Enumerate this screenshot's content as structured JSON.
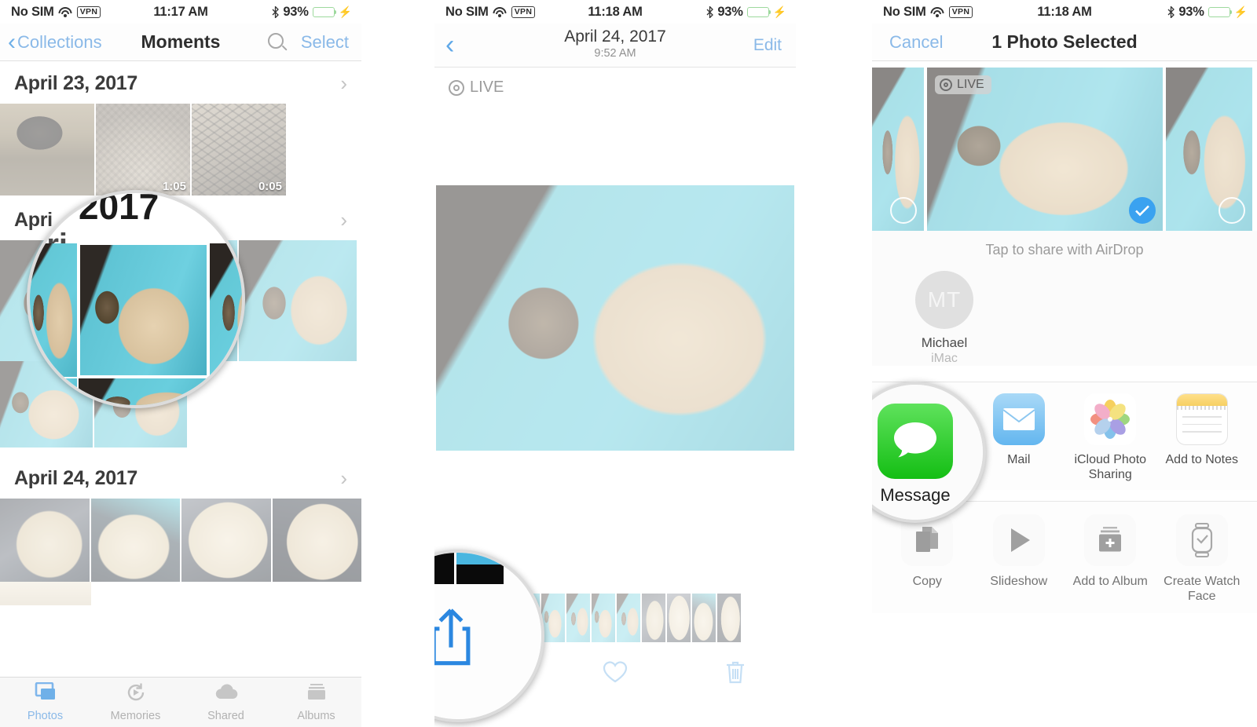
{
  "panels": [
    {
      "id": "moments",
      "status": {
        "carrier": "No SIM",
        "wifi_icon": "wifi-icon",
        "vpn": "VPN",
        "time": "11:17 AM",
        "bluetooth_icon": "bluetooth-icon",
        "battery_pct": "93%",
        "charging_icon": "lightning-bolt-icon"
      },
      "nav": {
        "back_label": "Collections",
        "title": "Moments",
        "search_icon": "search-icon",
        "select_label": "Select"
      },
      "sections": [
        {
          "date": "April 23, 2017",
          "chevron_icon": "chevron-right-icon",
          "photos": [
            {
              "name": "black-dog-in-store",
              "duration": ""
            },
            {
              "name": "dog-on-couch",
              "duration": "1:05"
            },
            {
              "name": "dog-in-crate",
              "duration": "0:05"
            }
          ]
        },
        {
          "date": "April 24, 2017",
          "chevron_icon": "chevron-right-icon",
          "photos": [
            {
              "name": "lab-in-car-1",
              "duration": ""
            },
            {
              "name": "lab-in-car-2",
              "duration": ""
            },
            {
              "name": "lab-in-car-3",
              "duration": ""
            },
            {
              "name": "lab-in-car-4",
              "duration": ""
            }
          ]
        }
      ],
      "magnifier": {
        "zoom_text": "2017",
        "partial_text": "Apri"
      },
      "tabs": [
        {
          "label": "Photos",
          "icon": "photos-stack-icon",
          "active": true
        },
        {
          "label": "Memories",
          "icon": "memories-rewind-icon",
          "active": false
        },
        {
          "label": "Shared",
          "icon": "cloud-icon",
          "active": false
        },
        {
          "label": "Albums",
          "icon": "albums-icon",
          "active": false
        }
      ]
    },
    {
      "id": "photo-detail",
      "status": {
        "carrier": "No SIM",
        "wifi_icon": "wifi-icon",
        "vpn": "VPN",
        "time": "11:18 AM",
        "bluetooth_icon": "bluetooth-icon",
        "battery_pct": "93%",
        "charging_icon": "lightning-bolt-icon"
      },
      "nav": {
        "back_icon": "chevron-left-icon",
        "title": "April 24, 2017",
        "subtitle": "9:52 AM",
        "edit_label": "Edit"
      },
      "live_badge": {
        "label": "LIVE",
        "icon": "live-photo-icon"
      },
      "main_photo": "dog-and-cat-on-teal-pillow",
      "bottom_actions": [
        {
          "name": "share-button",
          "icon": "share-up-arrow-icon"
        },
        {
          "name": "favorite-button",
          "icon": "heart-icon"
        },
        {
          "name": "delete-button",
          "icon": "trash-icon"
        }
      ],
      "magnifier": {
        "target": "share-button"
      }
    },
    {
      "id": "share-sheet",
      "status": {
        "carrier": "No SIM",
        "wifi_icon": "wifi-icon",
        "vpn": "VPN",
        "time": "11:18 AM",
        "bluetooth_icon": "bluetooth-icon",
        "battery_pct": "93%",
        "charging_icon": "lightning-bolt-icon"
      },
      "nav": {
        "cancel_label": "Cancel",
        "title": "1 Photo Selected"
      },
      "selection_strip": [
        {
          "name": "photo-thumb-prev",
          "selected": false
        },
        {
          "name": "photo-thumb-current",
          "selected": true,
          "live_label": "LIVE"
        },
        {
          "name": "photo-thumb-next",
          "selected": false
        }
      ],
      "airdrop": {
        "hint": "Tap to share with AirDrop",
        "contacts": [
          {
            "initials": "MT",
            "name": "Michael",
            "device": "iMac"
          }
        ]
      },
      "apps": [
        {
          "label": "Message",
          "icon": "messages-bubble-icon"
        },
        {
          "label": "Mail",
          "icon": "mail-envelope-icon"
        },
        {
          "label": "iCloud Photo Sharing",
          "icon": "photos-flower-icon"
        },
        {
          "label": "Add to Notes",
          "icon": "notes-icon"
        }
      ],
      "actions": [
        {
          "label": "Copy",
          "icon": "copy-pages-icon"
        },
        {
          "label": "Slideshow",
          "icon": "play-triangle-icon"
        },
        {
          "label": "Add to Album",
          "icon": "add-to-album-icon"
        },
        {
          "label": "Create Watch Face",
          "icon": "apple-watch-icon"
        }
      ],
      "magnifier": {
        "target": "message-app",
        "label": "Message"
      }
    }
  ],
  "colors": {
    "ios_blue": "#8ab9e8",
    "accent_blue": "#3aa2f0",
    "messages_green": "#18c018",
    "mail_blue": "#63b6ef",
    "text_dark": "#2e2e2e",
    "text_muted": "#9b9b9b"
  }
}
